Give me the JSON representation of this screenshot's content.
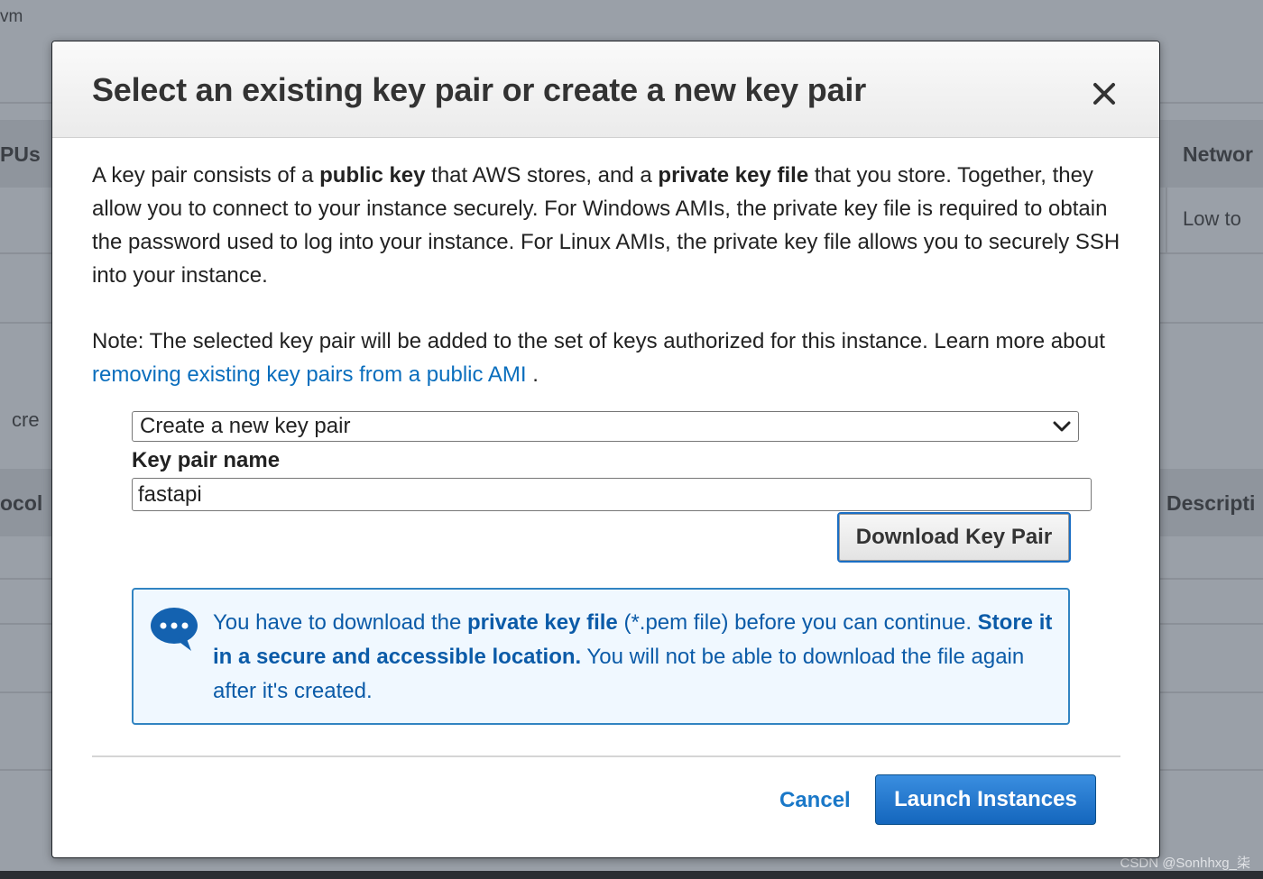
{
  "background": {
    "top_left_text": "vm",
    "col_vcpus": "PUs",
    "col_network": "Networ",
    "network_value": "Low to",
    "left_fragment": "cre",
    "col_protocol": "ocol",
    "col_description": "Descripti",
    "watermark": "CSDN @Sonhhxg_柒"
  },
  "modal": {
    "title": "Select an existing key pair or create a new key pair",
    "paragraph1": {
      "t1": "A key pair consists of a ",
      "b1": "public key",
      "t2": " that AWS stores, and a ",
      "b2": "private key file",
      "t3": " that you store. Together, they allow you to connect to your instance securely. For Windows AMIs, the private key file is required to obtain the password used to log into your instance. For Linux AMIs, the private key file allows you to securely SSH into your instance."
    },
    "paragraph2": {
      "t1": "Note: The selected key pair will be added to the set of keys authorized for this instance. Learn more about ",
      "link": "removing existing key pairs from a public AMI",
      "t2": " ."
    },
    "key_pair_select": {
      "selected": "Create a new key pair"
    },
    "key_pair_name": {
      "label": "Key pair name",
      "value": "fastapi"
    },
    "download_button": "Download Key Pair",
    "info": {
      "t1": "You have to download the ",
      "b1": "private key file",
      "t2": " (*.pem file) before you can continue. ",
      "b2": "Store it in a secure and accessible location.",
      "t3": " You will not be able to download the file again after it's created."
    },
    "cancel_label": "Cancel",
    "launch_label": "Launch Instances"
  },
  "colors": {
    "link": "#0a6ebd",
    "info_text": "#0b5ba8",
    "info_border": "#3184c2",
    "primary_button": "#1466bd"
  }
}
